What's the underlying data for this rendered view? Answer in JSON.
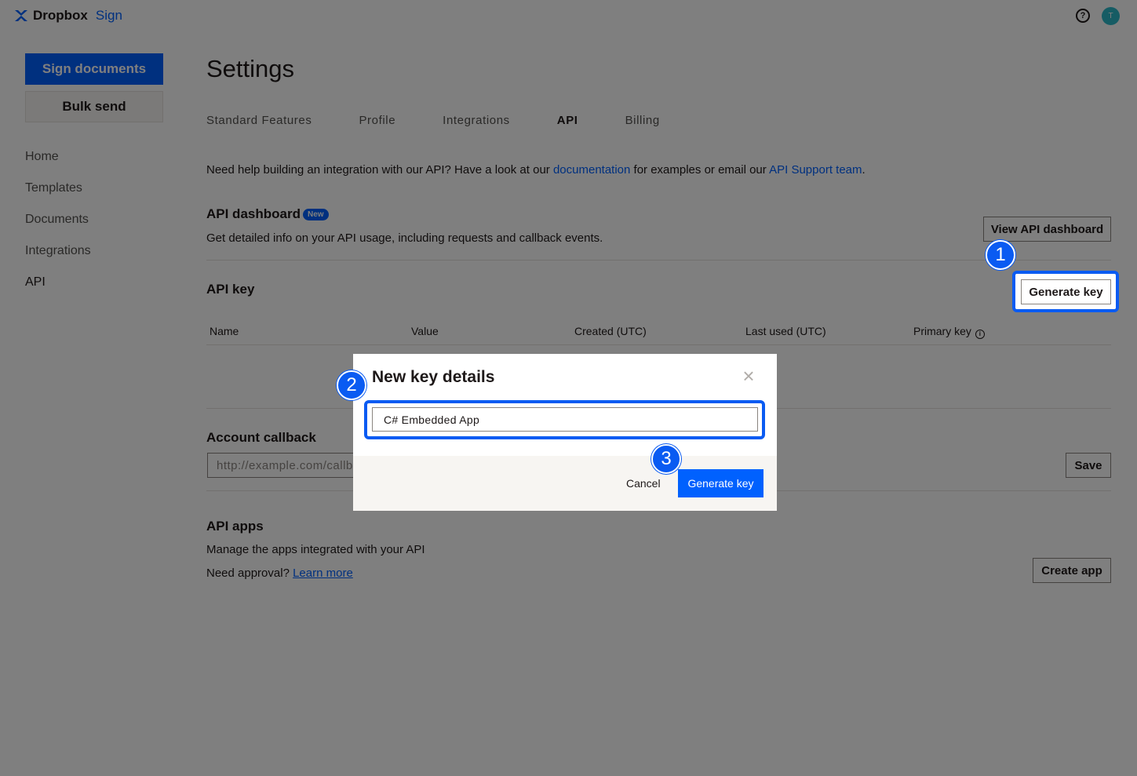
{
  "header": {
    "brand": "Dropbox",
    "product": "Sign",
    "help_icon": "question-circle-icon",
    "avatar_initial": "T"
  },
  "sidebar": {
    "primary_button": "Sign documents",
    "secondary_button": "Bulk send",
    "items": [
      {
        "label": "Home"
      },
      {
        "label": "Templates"
      },
      {
        "label": "Documents"
      },
      {
        "label": "Integrations"
      },
      {
        "label": "API"
      }
    ]
  },
  "main": {
    "title": "Settings",
    "tabs": [
      {
        "label": "Standard Features"
      },
      {
        "label": "Profile"
      },
      {
        "label": "Integrations"
      },
      {
        "label": "API"
      },
      {
        "label": "Billing"
      }
    ],
    "help": {
      "prefix": "Need help building an integration with our API? Have a look at our ",
      "doc_link": "documentation",
      "middle": " for examples or email our ",
      "support_link": "API Support team",
      "suffix": "."
    },
    "api_dashboard": {
      "title": "API dashboard",
      "badge": "New",
      "description": "Get detailed info on your API usage, including requests and callback events.",
      "button": "View API dashboard"
    },
    "api_key": {
      "title": "API key",
      "button": "Generate key",
      "columns": [
        "Name",
        "Value",
        "Created (UTC)",
        "Last used (UTC)",
        "Primary key"
      ]
    },
    "account_callback": {
      "title": "Account callback",
      "placeholder": "http://example.com/callback",
      "button": "Save"
    },
    "api_apps": {
      "title": "API apps",
      "description": "Manage the apps integrated with your API",
      "approval_prefix": "Need approval? ",
      "approval_link": "Learn more",
      "button": "Create app"
    }
  },
  "modal": {
    "title": "New key details",
    "input_value": "C# Embedded App",
    "cancel": "Cancel",
    "confirm": "Generate key"
  },
  "callouts": [
    "1",
    "2",
    "3"
  ],
  "colors": {
    "accent": "#0061fe",
    "callout": "#0a5bf2"
  }
}
